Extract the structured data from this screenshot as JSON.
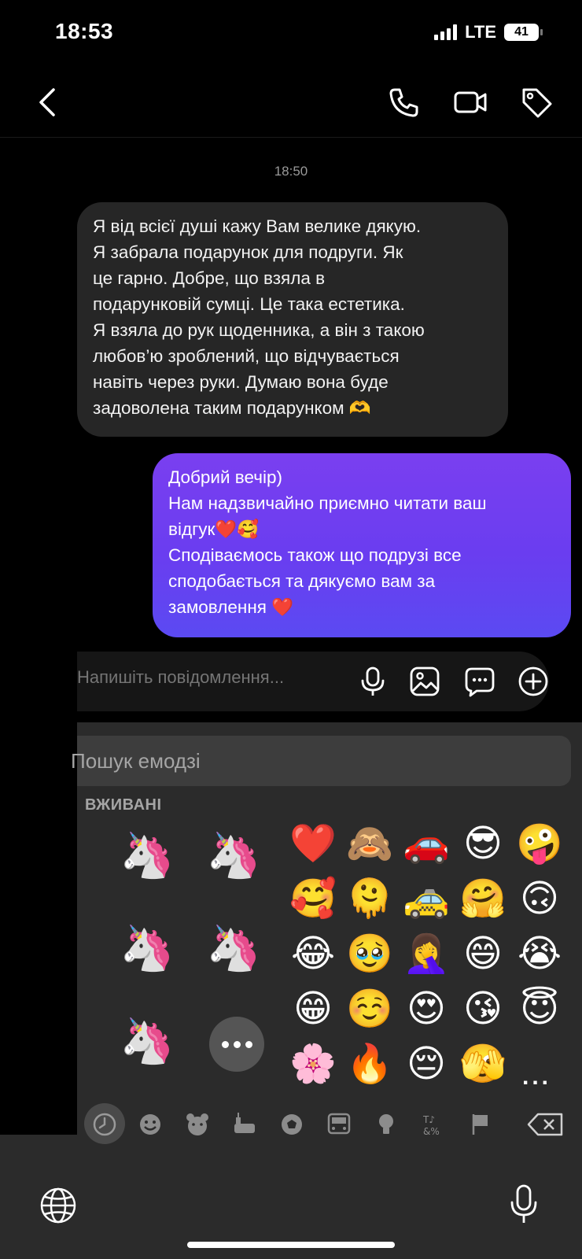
{
  "status_bar": {
    "time": "18:53",
    "network": "LTE",
    "battery": "41"
  },
  "header": {
    "icons": [
      "back-icon",
      "phone-icon",
      "video-icon",
      "tag-icon"
    ]
  },
  "chat": {
    "timestamp": "18:50",
    "incoming": {
      "lines": [
        "Я від всієї душі кажу Вам велике дякую.",
        "Я забрала подарунок для подруги. Як",
        "це гарно. Добре, що взяла в",
        "подарунковій сумці. Це така естетика.",
        "Я взяла до рук щоденника, а він з такою",
        "любов’ю зроблений, що відчувається",
        "навіть через руки. Думаю вона буде",
        "задоволена таким подарунком 🫶"
      ]
    },
    "outgoing": {
      "lines": [
        "Добрий вечір)",
        "Нам надзвичайно приємно читати ваш",
        "відгук❤️🥰",
        "Сподіваємось також що подрузі все",
        "сподобається та дякуємо вам за",
        "замовлення ❤️"
      ]
    }
  },
  "composer": {
    "placeholder": "Напишіть повідомлення..."
  },
  "keyboard": {
    "search_placeholder": "Пошук емодзі",
    "section_title": "ВЖИВАНІ",
    "stickers": [
      "🦄",
      "🦄",
      "🦄",
      "🦄",
      "🦄"
    ],
    "emoji_grid": [
      [
        "❤️",
        "🙈",
        "🚗",
        "😎",
        "🤪"
      ],
      [
        "🥰",
        "🫠",
        "🚕",
        "🤗",
        "🙃"
      ],
      [
        "😂",
        "🥹",
        "🤦‍♀️",
        "😄",
        "😭"
      ],
      [
        "😁",
        "☺️",
        "😍",
        "😘",
        "😇"
      ],
      [
        "🌸",
        "🔥",
        "😔",
        "🫣",
        ""
      ]
    ],
    "more_label": "...",
    "categories": [
      "clock-icon",
      "smiley-icon",
      "bear-icon",
      "food-icon",
      "ball-icon",
      "car-icon",
      "bulb-icon",
      "symbols-icon",
      "flag-icon",
      "backspace-icon"
    ]
  }
}
